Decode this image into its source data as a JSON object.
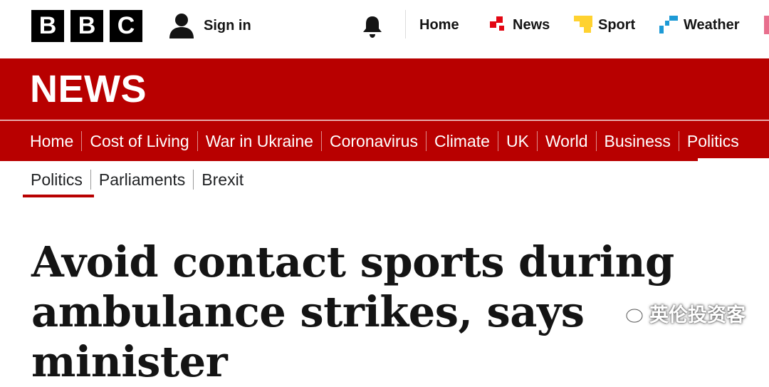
{
  "header": {
    "logo": [
      "B",
      "B",
      "C"
    ],
    "sign_in": "Sign in",
    "nav": [
      {
        "label": "Home",
        "icon": "none"
      },
      {
        "label": "News",
        "icon": "news-icon",
        "color": "#e30613"
      },
      {
        "label": "Sport",
        "icon": "sport-icon",
        "color": "#ffd230"
      },
      {
        "label": "Weather",
        "icon": "weather-icon",
        "color": "#1d9ad6"
      }
    ]
  },
  "section": {
    "title": "NEWS",
    "color": "#b80000",
    "nav": [
      "Home",
      "Cost of Living",
      "War in Ukraine",
      "Coronavirus",
      "Climate",
      "UK",
      "World",
      "Business",
      "Politics"
    ],
    "active": "Politics"
  },
  "sub_nav": {
    "items": [
      "Politics",
      "Parliaments",
      "Brexit"
    ],
    "active": "Politics"
  },
  "article": {
    "headline": "Avoid contact sports during ambulance strikes, says minister"
  },
  "watermark": {
    "text": "英伦投资客"
  }
}
